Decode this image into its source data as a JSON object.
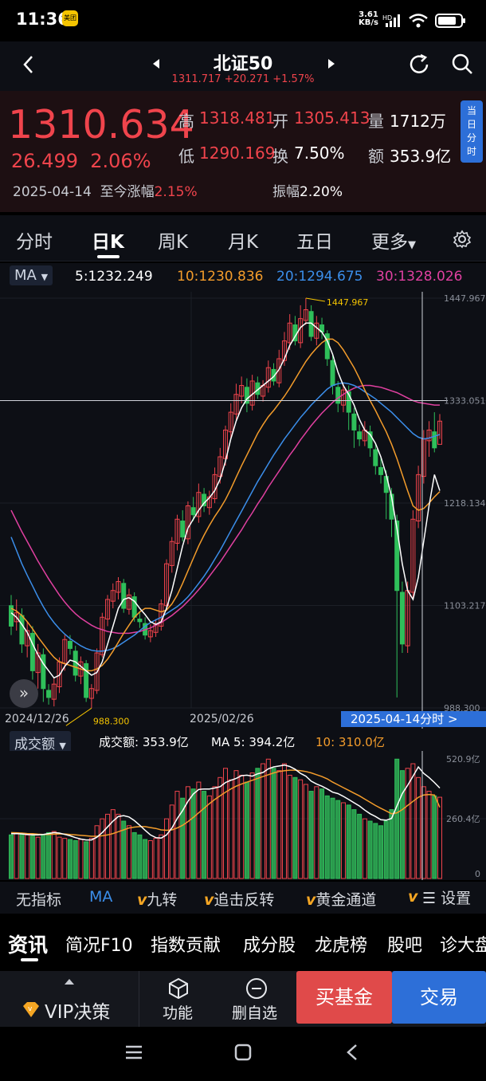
{
  "status": {
    "time": "11:36",
    "app_badge": "美团",
    "net_speed": "3.61",
    "net_unit": "KB/s"
  },
  "nav": {
    "title": "北证50",
    "price": "1311.717",
    "change": "+20.271",
    "change_pct": "+1.57%"
  },
  "quote": {
    "last": "1310.634",
    "change": "26.499",
    "change_pct": "2.06%",
    "high_label": "高",
    "high": "1318.481",
    "open_label": "开",
    "open": "1305.413",
    "vol_label": "量",
    "vol": "1712万",
    "low_label": "低",
    "low": "1290.169",
    "turnover_label": "换",
    "turnover": "7.50%",
    "amount_label": "额",
    "amount": "353.9亿",
    "date": "2025-04-14",
    "since_label": "至今涨幅",
    "since": "2.15%",
    "amp_label": "振幅",
    "amp": "2.20%",
    "intraday_btn": "当日分时"
  },
  "tabs": [
    "分时",
    "日K",
    "周K",
    "月K",
    "五日",
    "更多"
  ],
  "ma": {
    "label": "MA",
    "ma5": "5:1232.249",
    "ma10": "10:1230.836",
    "ma20": "20:1294.675",
    "ma30": "30:1328.026",
    "colors": {
      "ma5": "#ffffff",
      "ma10": "#f39c2b",
      "ma20": "#3b8eea",
      "ma30": "#e040a0"
    }
  },
  "chart_data": {
    "type": "candlestick",
    "y_ticks": [
      "1447.967",
      "1333.051",
      "1218.134",
      "1103.217",
      "988.300"
    ],
    "x_ticks": [
      "2024/12/26",
      "2025/02/26"
    ],
    "max_label": "1447.967",
    "min_label": "988.300",
    "crosshair_price": "1333.051",
    "crosshair_date": "2025-04-14分时 >",
    "candles": [
      [
        1103,
        1080,
        1115,
        1070
      ],
      [
        1085,
        1095,
        1110,
        1075
      ],
      [
        1092,
        1060,
        1100,
        1050
      ],
      [
        1058,
        1075,
        1085,
        1045
      ],
      [
        1072,
        1030,
        1080,
        1020
      ],
      [
        1028,
        1050,
        1060,
        1010
      ],
      [
        1048,
        1010,
        1055,
        995
      ],
      [
        1008,
        1000,
        1015,
        992
      ],
      [
        998,
        1015,
        1022,
        990
      ],
      [
        1012,
        1040,
        1045,
        1005
      ],
      [
        1038,
        1065,
        1070,
        1030
      ],
      [
        1063,
        1055,
        1070,
        1048
      ],
      [
        1052,
        1025,
        1058,
        1018
      ],
      [
        1024,
        1040,
        1046,
        1015
      ],
      [
        1038,
        1000,
        1042,
        995
      ],
      [
        999,
        1010,
        1015,
        988
      ],
      [
        1008,
        1050,
        1055,
        1004
      ],
      [
        1048,
        1090,
        1095,
        1045
      ],
      [
        1088,
        1110,
        1115,
        1080
      ],
      [
        1108,
        1120,
        1128,
        1100
      ],
      [
        1118,
        1130,
        1135,
        1110
      ],
      [
        1128,
        1100,
        1133,
        1095
      ],
      [
        1099,
        1115,
        1122,
        1093
      ],
      [
        1113,
        1090,
        1118,
        1085
      ],
      [
        1088,
        1085,
        1095,
        1078
      ],
      [
        1083,
        1070,
        1090,
        1065
      ],
      [
        1068,
        1075,
        1082,
        1062
      ],
      [
        1073,
        1082,
        1088,
        1068
      ],
      [
        1080,
        1105,
        1110,
        1075
      ],
      [
        1103,
        1150,
        1155,
        1100
      ],
      [
        1148,
        1175,
        1180,
        1140
      ],
      [
        1173,
        1200,
        1205,
        1165
      ],
      [
        1198,
        1180,
        1210,
        1175
      ],
      [
        1178,
        1215,
        1220,
        1172
      ],
      [
        1213,
        1205,
        1225,
        1198
      ],
      [
        1203,
        1230,
        1240,
        1196
      ],
      [
        1228,
        1215,
        1235,
        1208
      ],
      [
        1213,
        1225,
        1232,
        1205
      ],
      [
        1223,
        1250,
        1258,
        1218
      ],
      [
        1248,
        1270,
        1280,
        1240
      ],
      [
        1268,
        1300,
        1305,
        1260
      ],
      [
        1298,
        1320,
        1330,
        1290
      ],
      [
        1318,
        1340,
        1352,
        1310
      ],
      [
        1338,
        1350,
        1360,
        1330
      ],
      [
        1348,
        1330,
        1358,
        1320
      ],
      [
        1328,
        1355,
        1362,
        1322
      ],
      [
        1353,
        1340,
        1360,
        1335
      ],
      [
        1338,
        1350,
        1356,
        1332
      ],
      [
        1348,
        1370,
        1378,
        1342
      ],
      [
        1368,
        1355,
        1375,
        1350
      ],
      [
        1353,
        1380,
        1390,
        1348
      ],
      [
        1378,
        1400,
        1410,
        1372
      ],
      [
        1398,
        1420,
        1430,
        1390
      ],
      [
        1418,
        1400,
        1428,
        1395
      ],
      [
        1398,
        1425,
        1440,
        1392
      ],
      [
        1423,
        1435,
        1448,
        1418
      ],
      [
        1433,
        1405,
        1440,
        1400
      ],
      [
        1403,
        1420,
        1428,
        1395
      ],
      [
        1418,
        1410,
        1426,
        1402
      ],
      [
        1408,
        1380,
        1412,
        1372
      ],
      [
        1378,
        1350,
        1385,
        1340
      ],
      [
        1348,
        1330,
        1355,
        1320
      ],
      [
        1328,
        1345,
        1352,
        1320
      ],
      [
        1343,
        1320,
        1350,
        1300
      ],
      [
        1318,
        1300,
        1325,
        1280
      ],
      [
        1298,
        1290,
        1306,
        1282
      ],
      [
        1288,
        1300,
        1310,
        1282
      ],
      [
        1298,
        1280,
        1305,
        1270
      ],
      [
        1278,
        1260,
        1285,
        1250
      ],
      [
        1258,
        1250,
        1270,
        1240
      ],
      [
        1248,
        1230,
        1255,
        1200
      ],
      [
        1228,
        1200,
        1235,
        1180
      ],
      [
        1198,
        1120,
        1205,
        1000
      ],
      [
        1118,
        1060,
        1130,
        1050
      ],
      [
        1058,
        1120,
        1130,
        1050
      ],
      [
        1118,
        1200,
        1210,
        1110
      ],
      [
        1198,
        1250,
        1260,
        1190
      ],
      [
        1248,
        1290,
        1300,
        1240
      ],
      [
        1288,
        1300,
        1310,
        1270
      ],
      [
        1298,
        1280,
        1320,
        1275
      ],
      [
        1284,
        1310,
        1318,
        1290
      ]
    ],
    "ma5": [
      1095,
      1090,
      1082,
      1073,
      1060,
      1048,
      1038,
      1030,
      1022,
      1025,
      1035,
      1042,
      1040,
      1035,
      1030,
      1025,
      1028,
      1040,
      1060,
      1080,
      1100,
      1110,
      1112,
      1108,
      1100,
      1093,
      1085,
      1082,
      1085,
      1100,
      1120,
      1145,
      1170,
      1190,
      1200,
      1210,
      1218,
      1224,
      1232,
      1245,
      1265,
      1290,
      1310,
      1325,
      1335,
      1340,
      1345,
      1350,
      1355,
      1360,
      1368,
      1380,
      1395,
      1405,
      1415,
      1420,
      1420,
      1415,
      1410,
      1400,
      1385,
      1365,
      1350,
      1340,
      1328,
      1312,
      1300,
      1295,
      1285,
      1270,
      1250,
      1225,
      1190,
      1150,
      1120,
      1110,
      1135,
      1175,
      1215,
      1250,
      1232
    ],
    "ma10": [
      1100,
      1097,
      1092,
      1085,
      1077,
      1068,
      1060,
      1052,
      1045,
      1040,
      1038,
      1036,
      1034,
      1032,
      1030,
      1030,
      1032,
      1036,
      1043,
      1052,
      1062,
      1072,
      1081,
      1090,
      1096,
      1100,
      1100,
      1098,
      1096,
      1098,
      1105,
      1115,
      1128,
      1142,
      1156,
      1170,
      1182,
      1193,
      1203,
      1212,
      1222,
      1234,
      1247,
      1260,
      1272,
      1284,
      1296,
      1306,
      1315,
      1322,
      1330,
      1338,
      1347,
      1357,
      1367,
      1377,
      1385,
      1392,
      1398,
      1402,
      1402,
      1398,
      1390,
      1380,
      1370,
      1358,
      1345,
      1333,
      1322,
      1310,
      1298,
      1284,
      1268,
      1250,
      1232,
      1215,
      1210,
      1212,
      1218,
      1225,
      1231
    ],
    "ma20": [
      1180,
      1165,
      1150,
      1137,
      1125,
      1113,
      1102,
      1092,
      1084,
      1077,
      1071,
      1066,
      1062,
      1058,
      1055,
      1053,
      1052,
      1052,
      1053,
      1055,
      1058,
      1062,
      1066,
      1070,
      1075,
      1080,
      1084,
      1087,
      1090,
      1094,
      1098,
      1102,
      1107,
      1113,
      1120,
      1128,
      1136,
      1145,
      1155,
      1165,
      1176,
      1187,
      1198,
      1209,
      1220,
      1231,
      1242,
      1252,
      1262,
      1272,
      1281,
      1290,
      1298,
      1306,
      1314,
      1321,
      1328,
      1334,
      1340,
      1346,
      1350,
      1352,
      1353,
      1352,
      1350,
      1347,
      1343,
      1339,
      1335,
      1330,
      1325,
      1320,
      1314,
      1308,
      1302,
      1296,
      1292,
      1290,
      1291,
      1293,
      1295
    ],
    "ma30": [
      1210,
      1198,
      1186,
      1175,
      1164,
      1153,
      1143,
      1133,
      1124,
      1115,
      1107,
      1100,
      1094,
      1089,
      1085,
      1081,
      1078,
      1076,
      1074,
      1073,
      1072,
      1072,
      1072,
      1073,
      1074,
      1076,
      1078,
      1081,
      1084,
      1088,
      1092,
      1097,
      1102,
      1108,
      1114,
      1121,
      1128,
      1136,
      1144,
      1152,
      1161,
      1170,
      1179,
      1188,
      1198,
      1207,
      1217,
      1226,
      1236,
      1245,
      1254,
      1263,
      1272,
      1280,
      1289,
      1297,
      1305,
      1312,
      1319,
      1325,
      1331,
      1336,
      1340,
      1344,
      1347,
      1349,
      1350,
      1350,
      1349,
      1348,
      1346,
      1344,
      1342,
      1339,
      1336,
      1333,
      1331,
      1330,
      1329,
      1328,
      1328
    ]
  },
  "volume": {
    "label": "成交额",
    "amount": "成交额: 353.9亿",
    "ma5": "MA 5: 394.2亿",
    "ma10": "10: 310.0亿",
    "y_ticks": [
      "520.9亿",
      "260.4亿",
      "0"
    ],
    "values": [
      190,
      200,
      195,
      190,
      185,
      180,
      190,
      200,
      205,
      180,
      175,
      170,
      165,
      170,
      160,
      175,
      230,
      260,
      280,
      300,
      280,
      250,
      230,
      200,
      190,
      170,
      165,
      175,
      190,
      260,
      320,
      380,
      350,
      400,
      390,
      420,
      380,
      360,
      400,
      440,
      480,
      430,
      470,
      450,
      420,
      460,
      480,
      500,
      520,
      480,
      470,
      500,
      450,
      440,
      430,
      410,
      380,
      400,
      390,
      360,
      350,
      340,
      330,
      320,
      300,
      280,
      260,
      250,
      240,
      230,
      250,
      300,
      520,
      470,
      480,
      500,
      440,
      400,
      380,
      360,
      354
    ],
    "ma5_line": [
      195,
      196,
      194,
      192,
      190,
      190,
      192,
      196,
      200,
      198,
      192,
      186,
      178,
      172,
      168,
      168,
      180,
      200,
      225,
      250,
      270,
      274,
      268,
      252,
      232,
      210,
      190,
      178,
      176,
      190,
      220,
      262,
      296,
      336,
      368,
      388,
      390,
      390,
      394,
      400,
      418,
      428,
      436,
      448,
      450,
      446,
      456,
      462,
      478,
      486,
      490,
      494,
      488,
      476,
      458,
      446,
      424,
      412,
      402,
      390,
      376,
      370,
      358,
      344,
      330,
      316,
      298,
      282,
      270,
      256,
      254,
      262,
      316,
      370,
      406,
      446,
      486,
      458,
      440,
      418,
      394
    ],
    "ma10_line": [
      200,
      199,
      198,
      196,
      195,
      193,
      192,
      192,
      193,
      194,
      194,
      192,
      190,
      188,
      186,
      184,
      184,
      186,
      190,
      196,
      204,
      212,
      220,
      224,
      226,
      226,
      222,
      218,
      212,
      210,
      212,
      220,
      232,
      248,
      266,
      286,
      306,
      326,
      344,
      360,
      376,
      390,
      402,
      412,
      420,
      428,
      436,
      444,
      452,
      460,
      466,
      470,
      472,
      472,
      470,
      466,
      460,
      452,
      444,
      434,
      420,
      408,
      396,
      384,
      372,
      360,
      346,
      332,
      318,
      306,
      294,
      282,
      286,
      300,
      318,
      336,
      354,
      364,
      366,
      364,
      310
    ]
  },
  "indicators": [
    "无指标",
    "MA",
    "九转",
    "追击反转",
    "黄金通道",
    "设置"
  ],
  "info_tabs": [
    "资讯",
    "简况F10",
    "指数贡献",
    "成分股",
    "龙虎榜",
    "股吧",
    "诊大盘"
  ],
  "bottom": {
    "vip": "VIP决策",
    "func": "功能",
    "remove": "删自选",
    "buy": "买基金",
    "trade": "交易"
  }
}
